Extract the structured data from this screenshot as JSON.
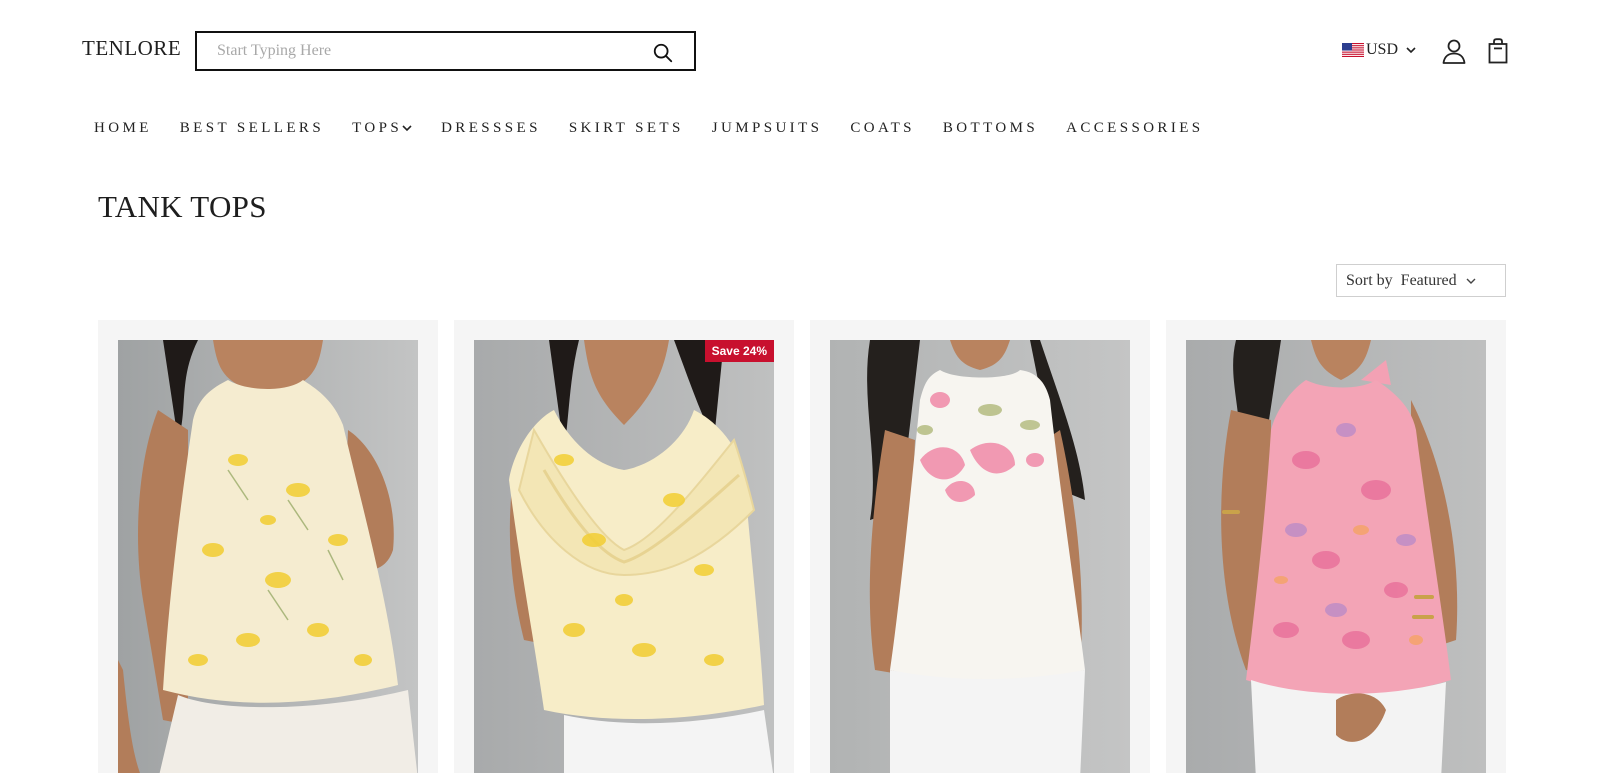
{
  "header": {
    "logo": "TENLORE",
    "search_placeholder": "Start Typing Here",
    "currency": "USD"
  },
  "nav": {
    "items": [
      {
        "label": "HOME"
      },
      {
        "label": "BEST SELLERS"
      },
      {
        "label": "TOPS",
        "has_dropdown": true
      },
      {
        "label": "DRESSSES"
      },
      {
        "label": "SKIRT SETS"
      },
      {
        "label": "JUMPSUITS"
      },
      {
        "label": "COATS"
      },
      {
        "label": "BOTTOMS"
      },
      {
        "label": "ACCESSORIES"
      }
    ]
  },
  "page": {
    "title": "TANK TOPS"
  },
  "sort": {
    "label": "Sort by",
    "value": "Featured"
  },
  "products": [
    {
      "badge": null,
      "description": "yellow floral halter top"
    },
    {
      "badge": "Save 24%",
      "description": "yellow floral ruffle top"
    },
    {
      "badge": null,
      "description": "white top with pink print"
    },
    {
      "badge": null,
      "description": "pink floral halter top"
    }
  ],
  "colors": {
    "badge": "#c8102e",
    "card_bg": "#f5f5f5",
    "photo_bg": "#aeb0b0"
  }
}
